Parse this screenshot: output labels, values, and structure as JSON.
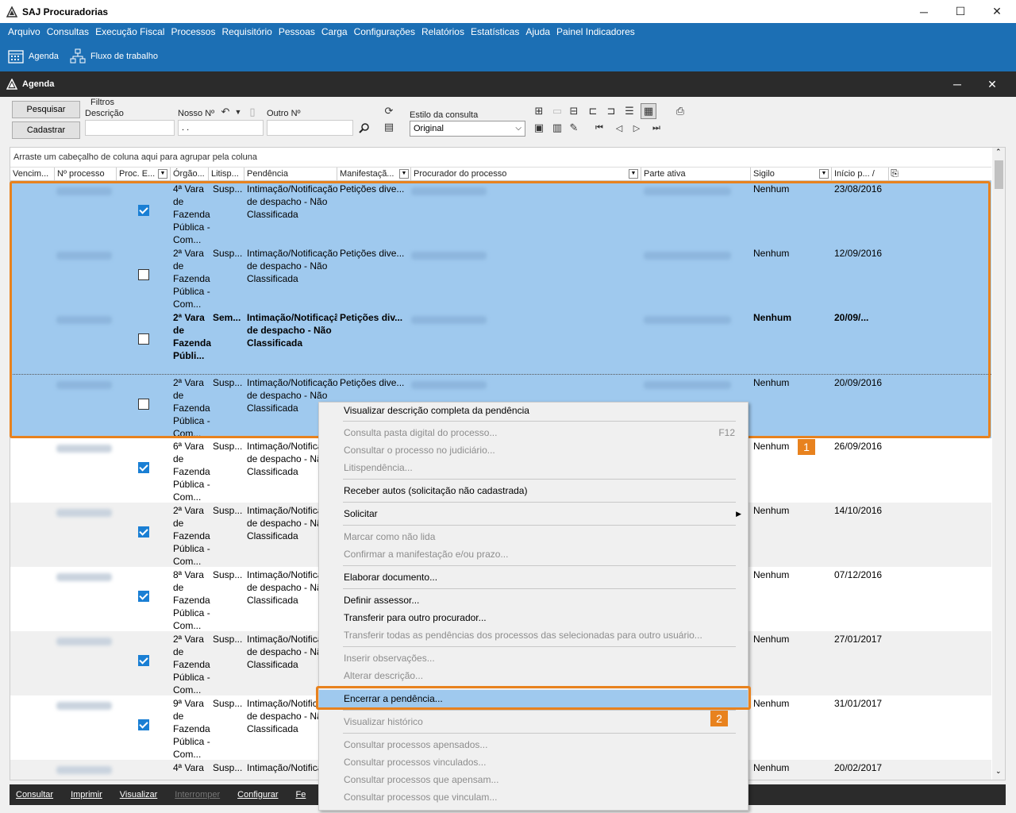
{
  "window": {
    "title": "SAJ Procuradorias",
    "min": "─",
    "max": "☐",
    "close": "✕"
  },
  "menu": [
    "Arquivo",
    "Consultas",
    "Execução Fiscal",
    "Processos",
    "Requisitório",
    "Pessoas",
    "Carga",
    "Configurações",
    "Relatórios",
    "Estatísticas",
    "Ajuda",
    "Painel Indicadores"
  ],
  "toolbar": {
    "agenda": "Agenda",
    "fluxo": "Fluxo de trabalho"
  },
  "agenda": {
    "title": "Agenda",
    "min": "─",
    "close": "✕"
  },
  "filters": {
    "pesquisar": "Pesquisar",
    "cadastrar": "Cadastrar",
    "group_label": "Filtros",
    "descricao_label": "Descrição",
    "descricao_value": "",
    "nosso_label": "Nosso Nº",
    "nosso_value": " . .",
    "outro_label": "Outro Nº",
    "outro_value": "",
    "estilo_label": "Estilo da consulta",
    "estilo_value": "Original"
  },
  "grid": {
    "group_hint": "Arraste um cabeçalho de coluna aqui para agrupar pela coluna",
    "columns": [
      "Vencim...",
      "Nº processo",
      "Proc. E...",
      "Órgão...",
      "Litisp...",
      "Pendência",
      "Manifestaçã...",
      "Procurador do processo",
      "Parte ativa",
      "Sigilo",
      "Início p...  /"
    ],
    "rows": [
      {
        "orgao": "4ª Vara de Fazenda Pública - Com...",
        "litisp": "Susp...",
        "pendencia": "Intimação/Notificação de despacho - Não Classificada",
        "manif": "Petições dive...",
        "sigilo": "Nenhum",
        "inicio": "23/08/2016",
        "checked": true,
        "selected": true,
        "bold": false
      },
      {
        "orgao": "2ª Vara de Fazenda Pública - Com...",
        "litisp": "Susp...",
        "pendencia": "Intimação/Notificação de despacho - Não Classificada",
        "manif": "Petições dive...",
        "sigilo": "Nenhum",
        "inicio": "12/09/2016",
        "checked": false,
        "selected": true,
        "bold": false
      },
      {
        "orgao": "2ª Vara de Fazenda Públi...",
        "litisp": "Sem...",
        "pendencia": "Intimação/Notificação de despacho - Não Classificada",
        "manif": "Petições div...",
        "sigilo": "Nenhum",
        "inicio": "20/09/...",
        "checked": false,
        "selected": true,
        "bold": true
      },
      {
        "orgao": "2ª Vara de Fazenda Pública - Com...",
        "litisp": "Susp...",
        "pendencia": "Intimação/Notificação de despacho - Não Classificada",
        "manif": "Petições dive...",
        "sigilo": "Nenhum",
        "inicio": "20/09/2016",
        "checked": false,
        "selected": true,
        "bold": false
      },
      {
        "orgao": "6ª Vara de Fazenda Pública - Com...",
        "litisp": "Susp...",
        "pendencia": "Intimação/Notificação de despacho - Não Classificada",
        "manif": "",
        "sigilo": "Nenhum",
        "inicio": "26/09/2016",
        "checked": true,
        "selected": false,
        "bold": false
      },
      {
        "orgao": "2ª Vara de Fazenda Pública - Com...",
        "litisp": "Susp...",
        "pendencia": "Intimação/Notificação de despacho - Não Classificada",
        "manif": "",
        "sigilo": "Nenhum",
        "inicio": "14/10/2016",
        "checked": true,
        "selected": false,
        "bold": false
      },
      {
        "orgao": "8ª Vara de Fazenda Pública - Com...",
        "litisp": "Susp...",
        "pendencia": "Intimação/Notificação de despacho - Não Classificada",
        "manif": "",
        "sigilo": "Nenhum",
        "inicio": "07/12/2016",
        "checked": true,
        "selected": false,
        "bold": false
      },
      {
        "orgao": "2ª Vara de Fazenda Pública - Com...",
        "litisp": "Susp...",
        "pendencia": "Intimação/Notificação de despacho - Não Classificada",
        "manif": "",
        "sigilo": "Nenhum",
        "inicio": "27/01/2017",
        "checked": true,
        "selected": false,
        "bold": false
      },
      {
        "orgao": "9ª Vara de Fazenda Pública - Com...",
        "litisp": "Susp...",
        "pendencia": "Intimação/Notificação de despacho - Não Classificada",
        "manif": "",
        "sigilo": "Nenhum",
        "inicio": "31/01/2017",
        "checked": true,
        "selected": false,
        "bold": false
      },
      {
        "orgao": "4ª Vara",
        "litisp": "Susp...",
        "pendencia": "Intimação/Notificação",
        "manif": "",
        "sigilo": "Nenhum",
        "inicio": "20/02/2017",
        "checked": false,
        "selected": false,
        "bold": false
      }
    ]
  },
  "bottom": [
    {
      "label": "Consultar",
      "disabled": false
    },
    {
      "label": "Imprimir",
      "disabled": false
    },
    {
      "label": "Visualizar",
      "disabled": false
    },
    {
      "label": "Interromper",
      "disabled": true
    },
    {
      "label": "Configurar",
      "disabled": false
    },
    {
      "label": "Fe",
      "disabled": false
    }
  ],
  "context_menu": [
    {
      "label": "Visualizar descrição completa da pendência",
      "disabled": false
    },
    {
      "label": "Consulta pasta digital do processo...",
      "disabled": true,
      "shortcut": "F12"
    },
    {
      "label": "Consultar o processo no judiciário...",
      "disabled": true
    },
    {
      "label": "Litispendência...",
      "disabled": true
    },
    {
      "label": "Receber autos (solicitação não cadastrada)",
      "disabled": false
    },
    {
      "label": "Solicitar",
      "disabled": false,
      "submenu": true
    },
    {
      "label": "Marcar como não lida",
      "disabled": true
    },
    {
      "label": "Confirmar a manifestação e/ou prazo...",
      "disabled": true
    },
    {
      "label": "Elaborar documento...",
      "disabled": false
    },
    {
      "label": "Definir assessor...",
      "disabled": false
    },
    {
      "label": "Transferir para outro procurador...",
      "disabled": false
    },
    {
      "label": "Transferir todas as pendências dos processos das selecionadas para outro usuário...",
      "disabled": true
    },
    {
      "label": "Inserir observações...",
      "disabled": true
    },
    {
      "label": "Alterar descrição...",
      "disabled": true
    },
    {
      "label": "Encerrar a pendência...",
      "disabled": false,
      "highlighted": true
    },
    {
      "label": "Visualizar histórico",
      "disabled": true
    },
    {
      "label": "Consultar processos apensados...",
      "disabled": true
    },
    {
      "label": "Consultar processos vinculados...",
      "disabled": true
    },
    {
      "label": "Consultar processos que apensam...",
      "disabled": true
    },
    {
      "label": "Consultar processos que vinculam...",
      "disabled": true
    }
  ],
  "badges": {
    "one": "1",
    "two": "2"
  },
  "colors": {
    "accent_blue": "#1c6fb4",
    "selection": "#9fc9ee",
    "highlight_orange": "#e8821e"
  }
}
